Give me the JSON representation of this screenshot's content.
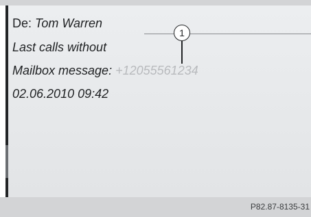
{
  "message": {
    "from_prefix": "De: ",
    "from_name": "Tom Warren",
    "line2": "Last calls without",
    "line3_label": "Mailbox message:",
    "line3_number": "+12055561234",
    "datetime": "02.06.2010 09:42"
  },
  "callout": {
    "number": "1"
  },
  "footer": {
    "figure_code": "P82.87-8135-31"
  },
  "colors": {
    "screen_bg": "#e6e8ea",
    "footer_bg": "#d3d4d6",
    "text": "#202224",
    "muted_number": "#b8babd"
  }
}
